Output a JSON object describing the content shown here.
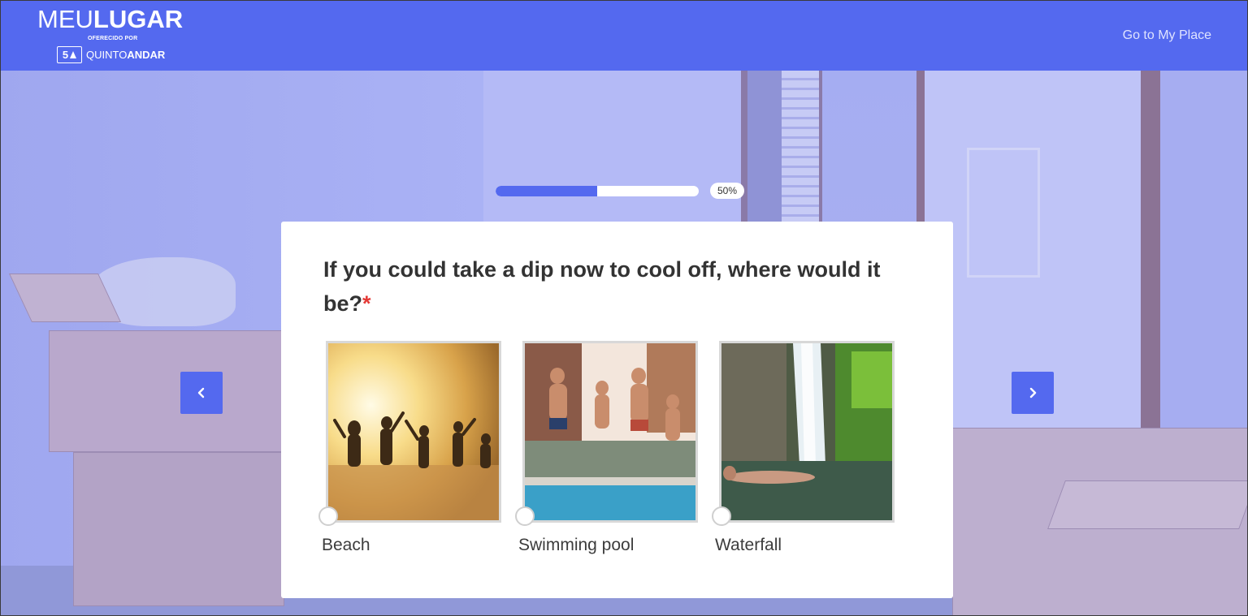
{
  "header": {
    "logo_light": "MEU",
    "logo_bold": "LUGAR",
    "logo_sub": "OFERECIDO POR",
    "partner_badge_num": "5",
    "partner_name_light": "QUINTO",
    "partner_name_bold": "ANDAR",
    "go_link": "Go to My Place"
  },
  "progress": {
    "value": 0.5,
    "label": "50%"
  },
  "question": {
    "text": "If you could take a dip now to cool off, where would it be?",
    "required_mark": "*"
  },
  "options": [
    {
      "label": "Beach",
      "icon": "beach-photo"
    },
    {
      "label": "Swimming pool",
      "icon": "pool-photo"
    },
    {
      "label": "Waterfall",
      "icon": "waterfall-photo"
    }
  ],
  "nav": {
    "prev_icon": "chevron-left-icon",
    "next_icon": "chevron-right-icon"
  },
  "colors": {
    "brand": "#5469ef",
    "required": "#e53935"
  }
}
